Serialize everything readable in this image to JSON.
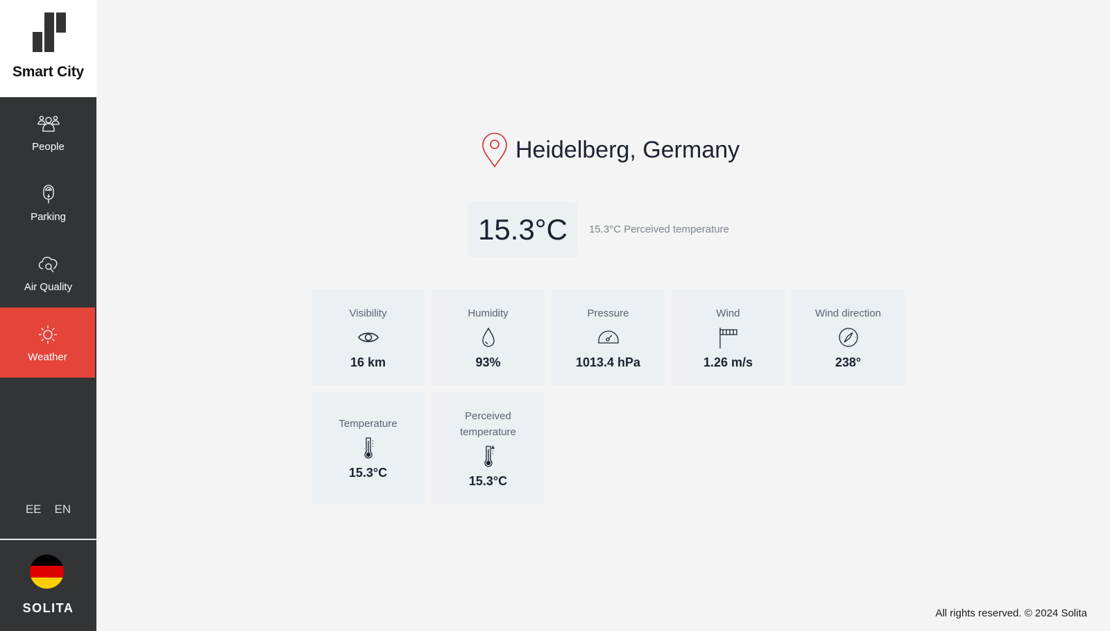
{
  "brand": {
    "title": "Smart City",
    "logo_icon": "bar-logo-icon"
  },
  "sidebar": {
    "items": [
      {
        "label": "People",
        "icon": "people-icon",
        "active": false
      },
      {
        "label": "Parking",
        "icon": "parking-meter-icon",
        "active": false
      },
      {
        "label": "Air Quality",
        "icon": "cloud-search-icon",
        "active": false
      },
      {
        "label": "Weather",
        "icon": "sun-icon",
        "active": true
      }
    ],
    "languages": [
      "EE",
      "EN"
    ],
    "country_flag": "germany-flag",
    "footer_brand": "SOLITA"
  },
  "colors": {
    "accent": "#e5443b",
    "sidebar_bg": "#333436",
    "card_bg": "#edf0f3",
    "page_bg": "#f4f4f4",
    "pin": "#d8272d",
    "flag": [
      "#000000",
      "#dd0000",
      "#ffce00"
    ]
  },
  "location": {
    "name": "Heidelberg, Germany",
    "icon": "map-pin-icon"
  },
  "current": {
    "temperature": "15.3°C",
    "perceived_text": "15.3°C Perceived temperature"
  },
  "cards": [
    {
      "label": "Visibility",
      "icon": "eye-icon",
      "value": "16 km"
    },
    {
      "label": "Humidity",
      "icon": "droplet-icon",
      "value": "93%"
    },
    {
      "label": "Pressure",
      "icon": "gauge-icon",
      "value": "1013.4 hPa"
    },
    {
      "label": "Wind",
      "icon": "windsock-icon",
      "value": "1.26 m/s"
    },
    {
      "label": "Wind direction",
      "icon": "compass-icon",
      "value": "238°"
    },
    {
      "label": "Temperature",
      "icon": "thermometer-icon",
      "value": "15.3°C"
    },
    {
      "label": "Perceived temperature",
      "icon": "thermometer-feel-icon",
      "value": "15.3°C"
    }
  ],
  "footer": {
    "text": "All rights reserved. © 2024 Solita"
  }
}
